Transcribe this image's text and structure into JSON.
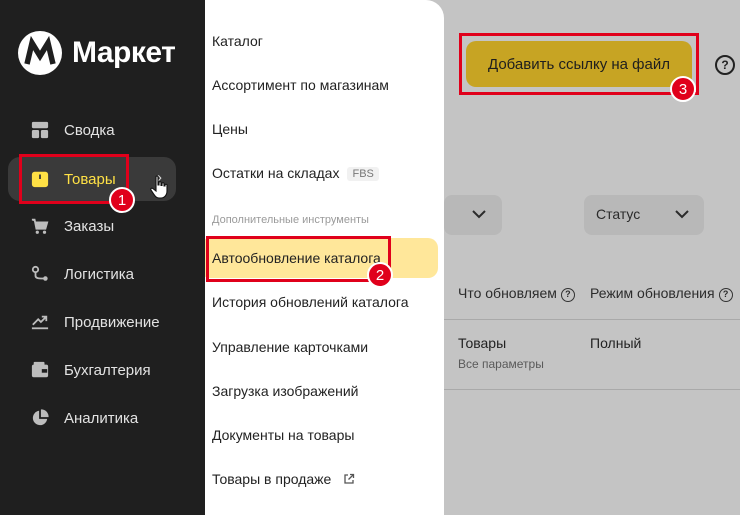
{
  "brand": {
    "name": "Маркет",
    "accent": "#ffe145"
  },
  "sidebar": {
    "items": [
      {
        "label": "Сводка",
        "icon": "dashboard-icon"
      },
      {
        "label": "Товары",
        "icon": "products-icon",
        "active": true
      },
      {
        "label": "Заказы",
        "icon": "cart-icon"
      },
      {
        "label": "Логистика",
        "icon": "route-icon"
      },
      {
        "label": "Продвижение",
        "icon": "chart-up-icon"
      },
      {
        "label": "Бухгалтерия",
        "icon": "wallet-icon"
      },
      {
        "label": "Аналитика",
        "icon": "pie-icon"
      }
    ]
  },
  "menu": {
    "items": [
      {
        "label": "Каталог"
      },
      {
        "label": "Ассортимент по магазинам"
      },
      {
        "label": "Цены"
      },
      {
        "label": "Остатки на складах",
        "badge": "FBS"
      }
    ],
    "section_title": "Дополнительные инструменты",
    "extra_items": [
      {
        "label": "Автообновление каталога",
        "highlighted": true
      },
      {
        "label": "История обновлений каталога"
      },
      {
        "label": "Управление карточками"
      },
      {
        "label": "Загрузка изображений"
      },
      {
        "label": "Документы на товары"
      },
      {
        "label": "Товары в продаже",
        "external": true
      }
    ]
  },
  "content": {
    "add_file_button": "Добавить ссылку на файл",
    "help": "?",
    "status_filter": "Статус",
    "columns": [
      "Что обновляем",
      "Режим обновления"
    ],
    "row": {
      "what": "Товары",
      "what_sub": "Все параметры",
      "mode": "Полный"
    }
  },
  "annotations": {
    "step1": "1",
    "step2": "2",
    "step3": "3",
    "color": "#e0001b"
  }
}
